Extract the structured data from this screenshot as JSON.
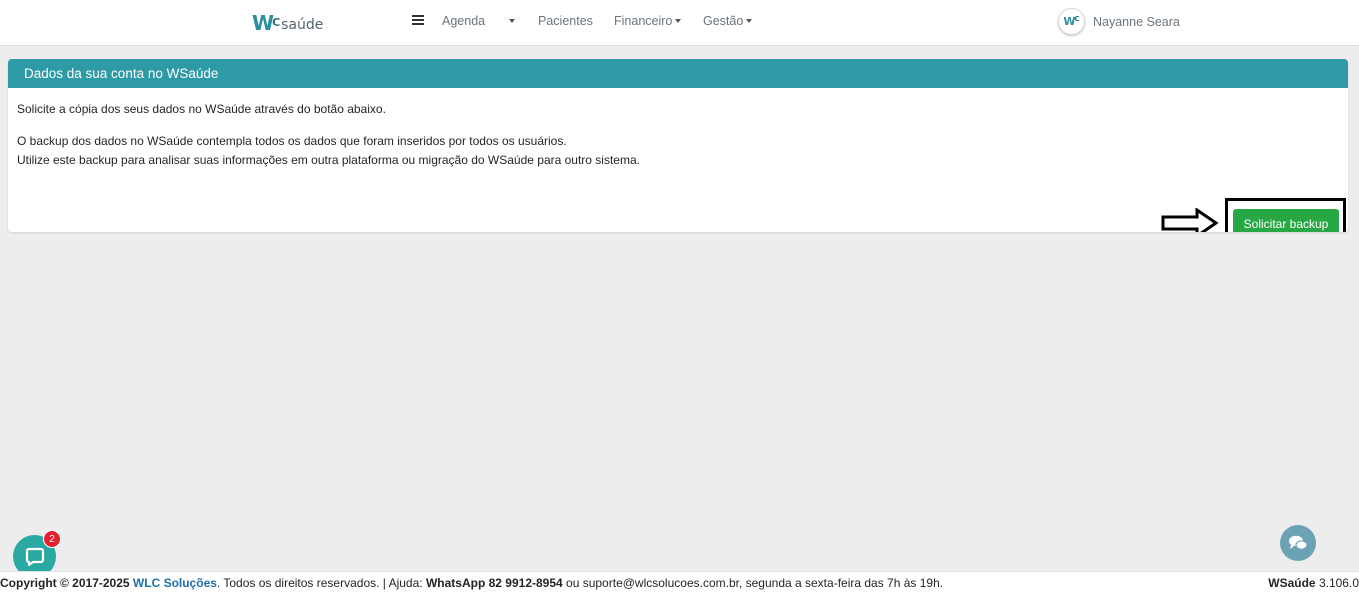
{
  "navbar": {
    "logo_mark": "W",
    "logo_mark_small": "C",
    "logo_text": "saúde",
    "menu": {
      "agenda": "Agenda",
      "pacientes": "Pacientes",
      "financeiro": "Financeiro",
      "gestao": "Gestão"
    },
    "user_name": "Nayanne Seara",
    "avatar_text": "W",
    "avatar_text_small": "C"
  },
  "card": {
    "title": "Dados da sua conta no WSaúde",
    "line1": "Solicite a cópia dos seus dados no WSaúde através do botão abaixo.",
    "line2": "O backup dos dados no WSaúde contempla todos os dados que foram inseridos por todos os usuários.",
    "line3": "Utilize este backup para analisar suas informações em outra plataforma ou migração do WSaúde para outro sistema.",
    "button_label": "Solicitar backup"
  },
  "footer": {
    "copyright": "Copyright © 2017-2025",
    "company": "WLC Soluções",
    "rights": ". Todos os direitos reservados. | Ajuda:",
    "whatsapp": "WhatsApp 82 9912-8954",
    "support": "ou suporte@wlcsolucoes.com.br, segunda a sexta-feira das 7h às 19h.",
    "app_name": "WSaúde",
    "version": "3.106.0"
  },
  "chat": {
    "badge_count": "2"
  },
  "colors": {
    "header_teal": "#2e9aa6",
    "button_green": "#28a745",
    "badge_red": "#e8202e"
  }
}
